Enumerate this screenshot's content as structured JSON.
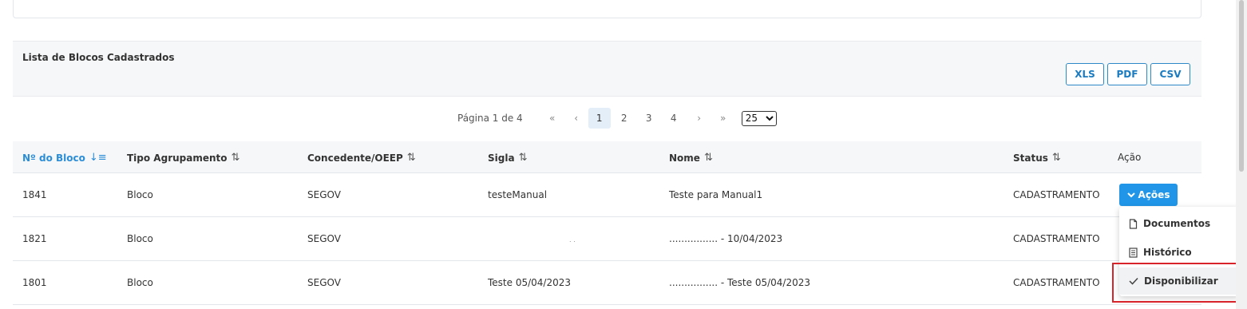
{
  "list": {
    "title": "Lista de Blocos Cadastrados",
    "export_buttons": [
      "XLS",
      "PDF",
      "CSV"
    ]
  },
  "pagination": {
    "info": "Página 1 de 4",
    "first": "«",
    "prev": "‹",
    "pages": [
      "1",
      "2",
      "3",
      "4"
    ],
    "current": "1",
    "next": "›",
    "last": "»",
    "page_size": "25"
  },
  "table": {
    "columns": [
      "Nº do Bloco",
      "Tipo Agrupamento",
      "Concedente/OEEP",
      "Sigla",
      "Nome",
      "Status",
      "Ação"
    ],
    "sorted_column": "Nº do Bloco",
    "rows": [
      {
        "numero": "1841",
        "tipo": "Bloco",
        "concedente": "SEGOV",
        "sigla": "testeManual",
        "nome": "Teste para Manual1",
        "status": "CADASTRAMENTO"
      },
      {
        "numero": "1821",
        "tipo": "Bloco",
        "concedente": "SEGOV",
        "sigla": ". .",
        "nome": "................ - 10/04/2023",
        "status": "CADASTRAMENTO"
      },
      {
        "numero": "1801",
        "tipo": "Bloco",
        "concedente": "SEGOV",
        "sigla": "Teste 05/04/2023",
        "nome": "................ - Teste 05/04/2023",
        "status": "CADASTRAMENTO"
      }
    ],
    "action_button": "Ações"
  },
  "actions_menu": {
    "items": [
      {
        "label": "Documentos",
        "icon": "document-icon"
      },
      {
        "label": "Histórico",
        "icon": "list-icon"
      },
      {
        "label": "Disponibilizar",
        "icon": "check-icon"
      }
    ]
  },
  "colors": {
    "accent": "#2196e8",
    "highlight": "#d8232a"
  }
}
